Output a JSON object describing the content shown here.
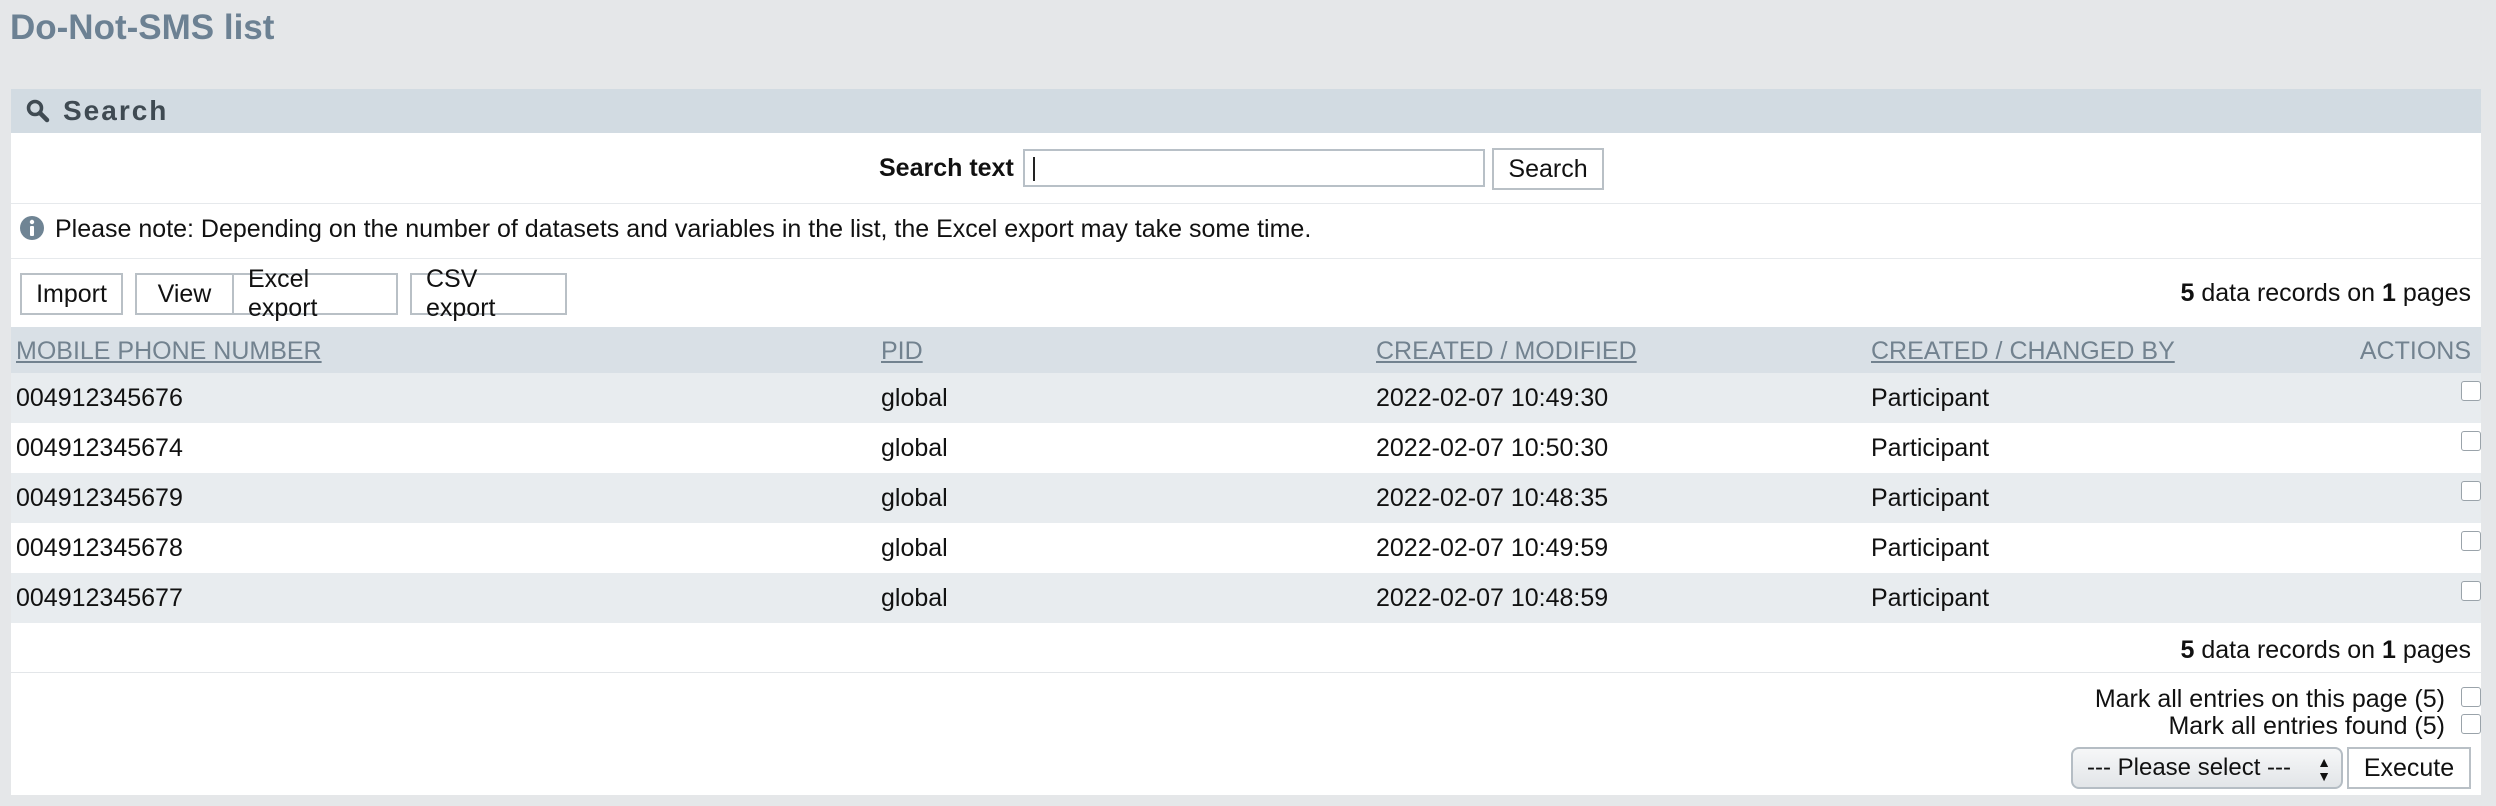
{
  "page": {
    "title": "Do-Not-SMS list"
  },
  "search": {
    "section_title": "Search",
    "label": "Search text",
    "value": "",
    "button": "Search"
  },
  "note": "Please note: Depending on the number of datasets and variables in the list, the Excel export may take some time.",
  "toolbar": {
    "import": "Import",
    "view": "View",
    "excel_export": "Excel export",
    "csv_export": "CSV export"
  },
  "records_summary": {
    "count": "5",
    "middle": " data records on ",
    "pages": "1",
    "suffix": " pages"
  },
  "table": {
    "columns": [
      "MOBILE PHONE NUMBER",
      "PID",
      "CREATED / MODIFIED",
      "CREATED / CHANGED BY",
      "ACTIONS"
    ],
    "rows": [
      {
        "phone": "004912345676",
        "pid": "global",
        "created": "2022-02-07 10:49:30",
        "by": "Participant",
        "checked": false
      },
      {
        "phone": "004912345674",
        "pid": "global",
        "created": "2022-02-07 10:50:30",
        "by": "Participant",
        "checked": false
      },
      {
        "phone": "004912345679",
        "pid": "global",
        "created": "2022-02-07 10:48:35",
        "by": "Participant",
        "checked": false
      },
      {
        "phone": "004912345678",
        "pid": "global",
        "created": "2022-02-07 10:49:59",
        "by": "Participant",
        "checked": false
      },
      {
        "phone": "004912345677",
        "pid": "global",
        "created": "2022-02-07 10:48:59",
        "by": "Participant",
        "checked": false
      }
    ]
  },
  "bulk": {
    "mark_page": "Mark all entries on this page (5)",
    "mark_found": "Mark all entries found (5)",
    "select_value": "--- Please select ---",
    "execute": "Execute"
  },
  "icons": {
    "search": "magnifier-icon",
    "info": "info-icon"
  },
  "colors": {
    "title": "#6c8193",
    "header_bg": "#d2dbe2",
    "column_header": "#72828f"
  }
}
